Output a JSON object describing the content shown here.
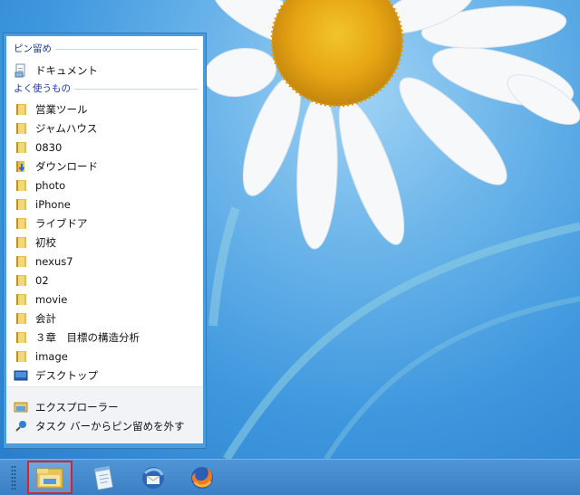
{
  "jumplist": {
    "pinned_header": "ピン留め",
    "pinned": [
      {
        "label": "ドキュメント",
        "icon": "document-icon"
      }
    ],
    "frequent_header": "よく使うもの",
    "frequent": [
      {
        "label": "営業ツール",
        "icon": "folder-icon"
      },
      {
        "label": "ジャムハウス",
        "icon": "folder-icon"
      },
      {
        "label": "0830",
        "icon": "folder-icon"
      },
      {
        "label": "ダウンロード",
        "icon": "downloads-folder-icon"
      },
      {
        "label": "photo",
        "icon": "folder-icon"
      },
      {
        "label": "iPhone",
        "icon": "folder-icon"
      },
      {
        "label": "ライブドア",
        "icon": "folder-icon"
      },
      {
        "label": "初校",
        "icon": "folder-icon"
      },
      {
        "label": "nexus7",
        "icon": "folder-icon"
      },
      {
        "label": "02",
        "icon": "folder-icon"
      },
      {
        "label": "movie",
        "icon": "folder-icon"
      },
      {
        "label": "会計",
        "icon": "folder-icon"
      },
      {
        "label": "３章　目標の構造分析",
        "icon": "folder-icon"
      },
      {
        "label": "image",
        "icon": "folder-icon"
      },
      {
        "label": "デスクトップ",
        "icon": "desktop-icon"
      }
    ],
    "tasks": [
      {
        "label": "エクスプローラー",
        "icon": "explorer-icon"
      },
      {
        "label": "タスク バーからピン留めを外す",
        "icon": "unpin-icon"
      }
    ]
  },
  "taskbar": {
    "apps": [
      "file-explorer-icon",
      "notepad-icon",
      "thunderbird-icon",
      "firefox-icon"
    ],
    "active": "file-explorer-icon",
    "highlight_color": "#d9222a"
  }
}
